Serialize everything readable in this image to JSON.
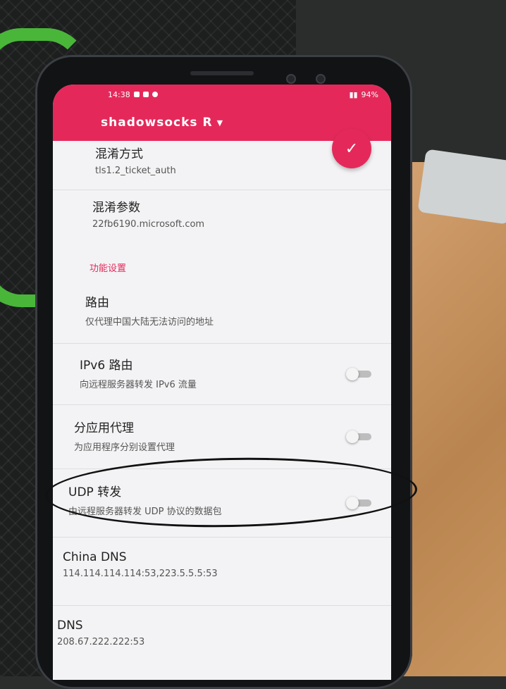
{
  "status_bar": {
    "time": "14:38",
    "battery": "94%"
  },
  "toolbar": {
    "title": "shadowsocks R",
    "dropdown_icon": "chevron-down-icon"
  },
  "fab": {
    "icon": "check-icon",
    "symbol": "✓"
  },
  "prefs": {
    "obfs": {
      "title": "混淆方式",
      "summary": "tls1.2_ticket_auth"
    },
    "obfs_param": {
      "title": "混淆参数",
      "summary": "22fb6190.microsoft.com"
    },
    "category": "功能设置",
    "route": {
      "title": "路由",
      "summary": "仅代理中国大陆无法访问的地址"
    },
    "ipv6": {
      "title": "IPv6 路由",
      "summary": "向远程服务器转发 IPv6 流量",
      "enabled": false
    },
    "per_app": {
      "title": "分应用代理",
      "summary": "为应用程序分别设置代理",
      "enabled": false
    },
    "udp": {
      "title": "UDP 转发",
      "summary": "由远程服务器转发 UDP 协议的数据包",
      "enabled": false
    },
    "china_dns": {
      "title": "China DNS",
      "summary": "114.114.114.114:53,223.5.5.5:53"
    },
    "dns": {
      "title": "DNS",
      "summary": "208.67.222.222:53"
    }
  },
  "colors": {
    "accent": "#e4295a",
    "switch_off_track": "#bdbdbd"
  }
}
